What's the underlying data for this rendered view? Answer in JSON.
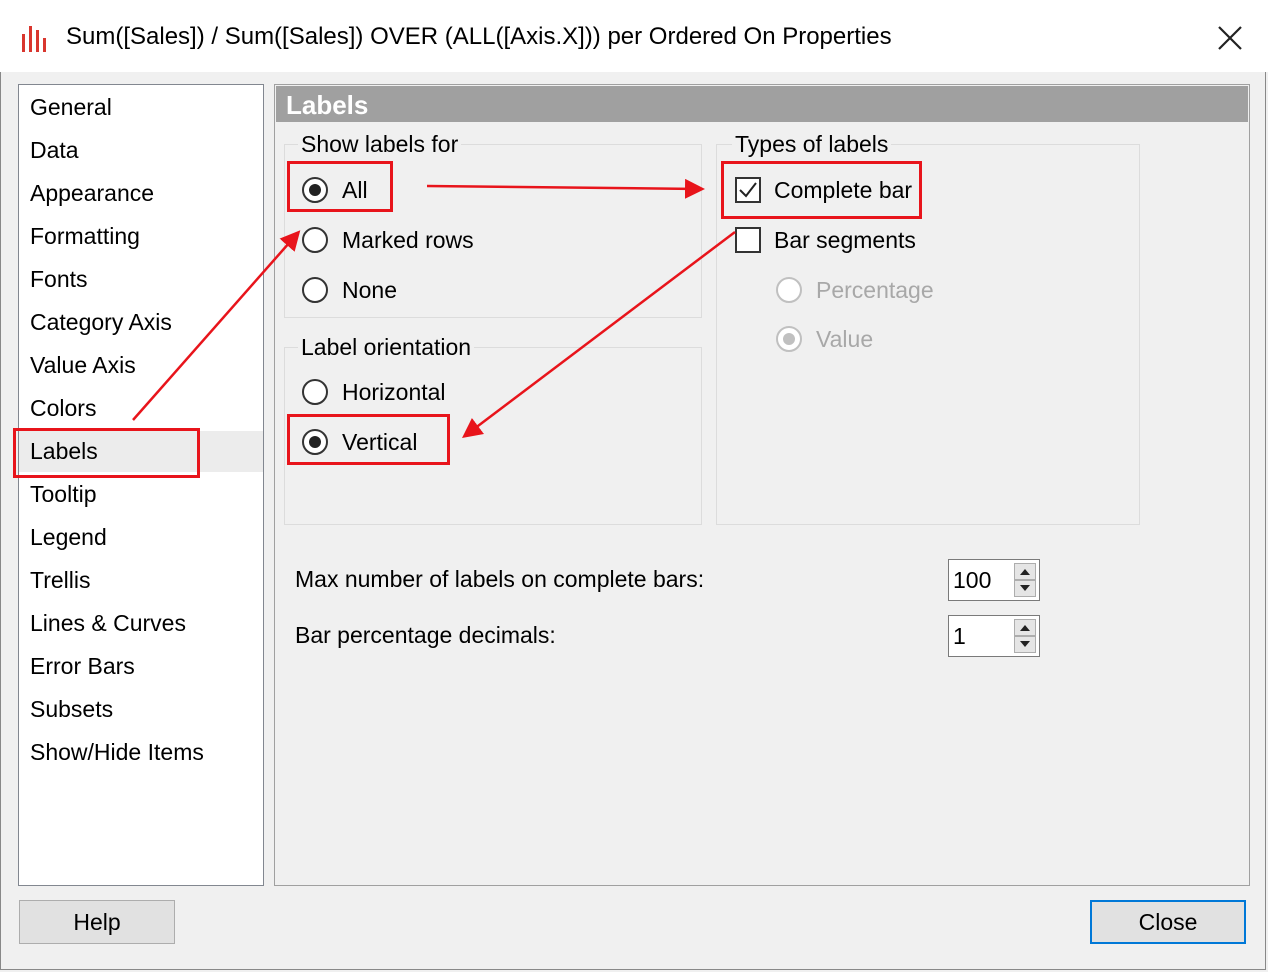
{
  "window": {
    "title": "Sum([Sales]) / Sum([Sales]) OVER (ALL([Axis.X])) per Ordered On Properties",
    "app_icon": "bar-chart-icon",
    "close_icon": "close-icon"
  },
  "nav": {
    "items": [
      {
        "label": "General"
      },
      {
        "label": "Data"
      },
      {
        "label": "Appearance"
      },
      {
        "label": "Formatting"
      },
      {
        "label": "Fonts"
      },
      {
        "label": "Category Axis"
      },
      {
        "label": "Value Axis"
      },
      {
        "label": "Colors"
      },
      {
        "label": "Labels"
      },
      {
        "label": "Tooltip"
      },
      {
        "label": "Legend"
      },
      {
        "label": "Trellis"
      },
      {
        "label": "Lines & Curves"
      },
      {
        "label": "Error Bars"
      },
      {
        "label": "Subsets"
      },
      {
        "label": "Show/Hide Items"
      }
    ],
    "selected": "Labels"
  },
  "panel": {
    "title": "Labels",
    "show_labels_for": {
      "label": "Show labels for",
      "options": [
        {
          "label": "All",
          "checked": true
        },
        {
          "label": "Marked rows",
          "checked": false
        },
        {
          "label": "None",
          "checked": false
        }
      ]
    },
    "label_orientation": {
      "label": "Label orientation",
      "options": [
        {
          "label": "Horizontal",
          "checked": false
        },
        {
          "label": "Vertical",
          "checked": true
        }
      ]
    },
    "types_of_labels": {
      "label": "Types of labels",
      "complete_bar": {
        "label": "Complete bar",
        "checked": true
      },
      "bar_segments": {
        "label": "Bar segments",
        "checked": false
      },
      "segment_options": [
        {
          "label": "Percentage",
          "checked": false,
          "enabled": false
        },
        {
          "label": "Value",
          "checked": true,
          "enabled": false
        }
      ]
    },
    "max_labels": {
      "label": "Max number of labels on complete bars:",
      "value": "100"
    },
    "bar_percentage_decimals": {
      "label": "Bar percentage decimals:",
      "value": "1"
    }
  },
  "buttons": {
    "help": "Help",
    "close": "Close"
  },
  "annotation_color": "#e8141b"
}
